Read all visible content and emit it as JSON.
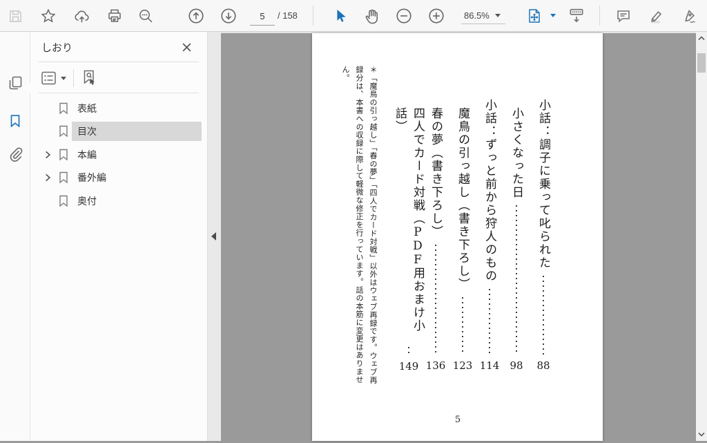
{
  "toolbar": {
    "page_current": "5",
    "page_total": "/ 158",
    "zoom_level": "86.5%",
    "icons": [
      "save-icon",
      "star-icon",
      "share-upload-icon",
      "print-icon",
      "search-icon",
      "page-up-icon",
      "page-down-icon",
      "select-tool-icon",
      "hand-tool-icon",
      "zoom-out-icon",
      "zoom-in-icon",
      "fit-page-icon",
      "show-toolbar-icon",
      "comment-icon",
      "highlight-icon",
      "sign-icon"
    ]
  },
  "sidebar": {
    "title": "しおり",
    "rail_icons": [
      "page-thumbnails-icon",
      "bookmarks-icon",
      "attachments-icon"
    ],
    "tool_icons": [
      "options-icon",
      "expand-current-bookmark-icon"
    ],
    "items": [
      {
        "label": "表紙",
        "expandable": false,
        "selected": false
      },
      {
        "label": "目次",
        "expandable": false,
        "selected": true
      },
      {
        "label": "本編",
        "expandable": true,
        "selected": false
      },
      {
        "label": "番外編",
        "expandable": true,
        "selected": false
      },
      {
        "label": "奥付",
        "expandable": false,
        "selected": false
      }
    ]
  },
  "page": {
    "folio": "5",
    "toc": [
      {
        "title": "小話：調子に乗って叱られた",
        "page": "88",
        "sub": true
      },
      {
        "title": "小さくなった日",
        "page": "98",
        "sub": false
      },
      {
        "title": "小話：ずっと前から狩人のもの",
        "page": "114",
        "sub": true
      },
      {
        "title": "魔鳥の引っ越し（書き下ろし）",
        "page": "123",
        "sub": false
      },
      {
        "title": "春の夢（書き下ろし）",
        "page": "136",
        "sub": false
      },
      {
        "title": "四人でカード対戦（PDF用おまけ小話）",
        "page": "149",
        "sub": false
      }
    ],
    "footnote": "＊「魔鳥の引っ越し」「春の夢」「四人でカード対戦」以外はウェブ再録です。ウェブ再録分は、本書への収録に際して軽微な修正を行っています。話の本筋に変更はありません。"
  },
  "colors": {
    "accent_blue": "#1b72b8",
    "toolbar_bg": "#f7f7f7",
    "doc_bg": "#9a9a9a",
    "selection_gray": "#d8d8d8"
  }
}
